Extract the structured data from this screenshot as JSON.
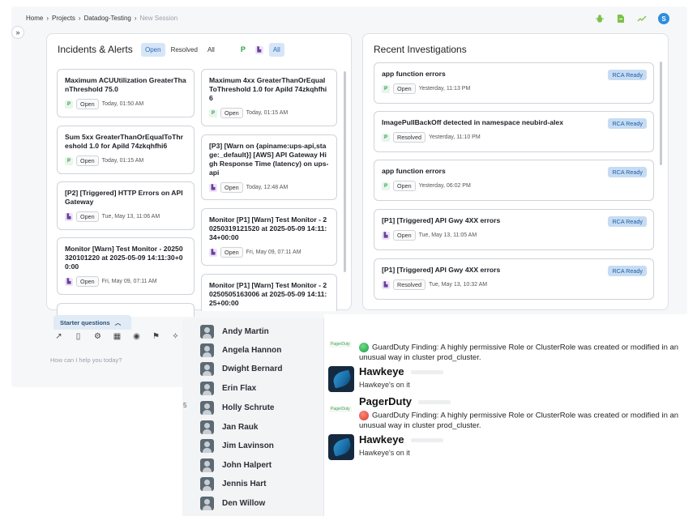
{
  "breadcrumb": {
    "home": "Home",
    "projects": "Projects",
    "project": "Datadog-Testing",
    "current": "New Session"
  },
  "top_actions": {
    "avatar_initial": "S"
  },
  "incidents": {
    "title": "Incidents & Alerts",
    "filters": {
      "open": "Open",
      "resolved": "Resolved",
      "all": "All",
      "source_p": "P",
      "source_all": "All"
    },
    "left_cards": [
      {
        "title": "Maximum ACUUtilization GreaterThanThreshold 75.0",
        "source": "P",
        "status": "Open",
        "time": "Today, 01:50 AM"
      },
      {
        "title": "Sum 5xx GreaterThanOrEqualToThreshold 1.0 for ApiId 74zkqhfhi6",
        "source": "P",
        "status": "Open",
        "time": "Today, 01:15 AM"
      },
      {
        "title": "[P2] [Triggered] HTTP Errors on APIGateway",
        "source": "DD",
        "status": "Open",
        "time": "Tue, May 13, 11:06 AM"
      },
      {
        "title": "Monitor [Warn] Test Monitor - 20250320101220 at 2025-05-09 14:11:30+00:00",
        "source": "DD",
        "status": "Open",
        "time": "Fri, May 09, 07:11 AM"
      }
    ],
    "right_cards": [
      {
        "title": "Maximum 4xx GreaterThanOrEqualToThreshold 1.0 for ApiId 74zkqhfhi6",
        "source": "P",
        "status": "Open",
        "time": "Today, 01:15 AM"
      },
      {
        "title": "[P3] [Warn on {apiname:ups-api,stage:_default}] [AWS] API Gateway High Response Time (latency) on ups-api",
        "source": "DD",
        "status": "Open",
        "time": "Today, 12:48 AM"
      },
      {
        "title": "Monitor [P1] [Warn] Test Monitor - 20250319121520 at 2025-05-09 14:11:34+00:00",
        "source": "DD",
        "status": "Open",
        "time": "Fri, May 09, 07:11 AM"
      },
      {
        "title": "Monitor [P1] [Warn] Test Monitor - 20250505163006 at 2025-05-09 14:11:25+00:00",
        "source": "DD",
        "status": "",
        "time": ""
      }
    ]
  },
  "investigations": {
    "title": "Recent Investigations",
    "items": [
      {
        "title": "app function errors",
        "badge": "RCA Ready",
        "source": "P",
        "status": "Open",
        "time": "Yesterday, 11:13 PM"
      },
      {
        "title": "ImagePullBackOff detected in namespace neubird-alex",
        "badge": "RCA Ready",
        "source": "P",
        "status": "Resolved",
        "time": "Yesterday, 11:10 PM"
      },
      {
        "title": "app function errors",
        "badge": "RCA Ready",
        "source": "P",
        "status": "Open",
        "time": "Yesterday, 06:02 PM"
      },
      {
        "title": "[P1] [Triggered] API Gwy 4XX errors",
        "badge": "RCA Ready",
        "source": "DD",
        "status": "Open",
        "time": "Tue, May 13, 11:05 AM"
      },
      {
        "title": "[P1] [Triggered] API Gwy 4XX errors",
        "badge": "RCA Ready",
        "source": "DD",
        "status": "Resolved",
        "time": "Tue, May 13, 10:32 AM"
      }
    ]
  },
  "starter": {
    "label": "Starter questions",
    "placeholder": "How can I help you today?"
  },
  "users": [
    "Andy Martin",
    "Angela Hannon",
    "Dwight Bernard",
    "Erin Flax",
    "Holly Schrute",
    "Jan Rauk",
    "Jim Lavinson",
    "John Halpert",
    "Jennis Hart",
    "Den Willow"
  ],
  "side_number": "5",
  "chat": {
    "pd_logo": "PagerDuty",
    "msg1": "GuardDuty Finding: A highly permissive Role or ClusterRole was created or modified in an unusual way in cluster prod_cluster.",
    "bot1_name": "Hawkeye",
    "bot1_text": "Hawkeye's on it",
    "pd_sender": "PagerDuty",
    "msg2": "GuardDuty Finding: A highly permissive Role or ClusterRole was created or modified in an unusual way in cluster prod_cluster.",
    "bot2_name": "Hawkeye",
    "bot2_text": "Hawkeye's on it"
  },
  "colors": {
    "accent": "#2b6cb0",
    "rca_bg": "#c7dcf3",
    "open_green": "#2a9b45"
  }
}
